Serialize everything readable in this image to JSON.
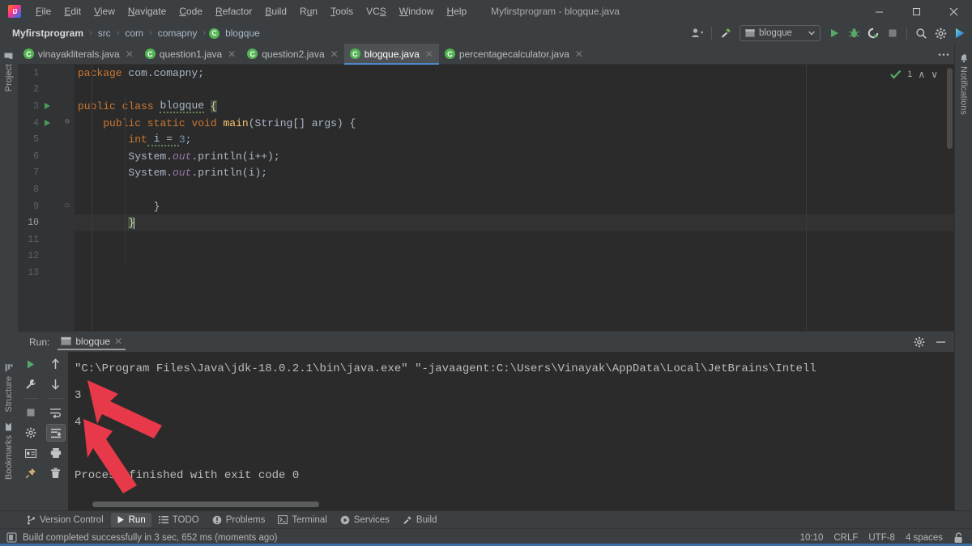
{
  "window": {
    "title": "Myfirstprogram - blogque.java",
    "minimize": "—",
    "maximize": "❐",
    "close": "✕"
  },
  "menu": [
    {
      "label": "File"
    },
    {
      "label": "Edit"
    },
    {
      "label": "View"
    },
    {
      "label": "Navigate"
    },
    {
      "label": "Code"
    },
    {
      "label": "Refactor"
    },
    {
      "label": "Build"
    },
    {
      "label": "Run"
    },
    {
      "label": "Tools"
    },
    {
      "label": "VCS"
    },
    {
      "label": "Window"
    },
    {
      "label": "Help"
    }
  ],
  "navbar": {
    "breadcrumb": [
      "Myfirstprogram",
      "src",
      "com",
      "comapny",
      "blogque"
    ],
    "separator": "›",
    "run_config": "blogque",
    "icons": [
      "user-icon",
      "hammer-icon",
      "run-icon",
      "debug-icon",
      "run-with-coverage-icon",
      "stop-icon",
      "search-icon",
      "settings-icon",
      "updates-icon"
    ]
  },
  "tool_strips": {
    "left_top": "Project",
    "left_mid": "Bookmarks",
    "left_bottom": "Structure",
    "right": "Notifications"
  },
  "editor_tabs": [
    {
      "label": "vinayakliterals.java",
      "active": false
    },
    {
      "label": "question1.java",
      "active": false
    },
    {
      "label": "question2.java",
      "active": false
    },
    {
      "label": "blogque.java",
      "active": true
    },
    {
      "label": "percentagecalculator.java",
      "active": false
    }
  ],
  "inspection": {
    "count": "1",
    "up": "∧",
    "down": "∨"
  },
  "code": {
    "lines": [
      {
        "n": "1",
        "runmark": false,
        "fold": "",
        "current": false
      },
      {
        "n": "2",
        "runmark": false,
        "fold": "",
        "current": false
      },
      {
        "n": "3",
        "runmark": true,
        "fold": "",
        "current": false
      },
      {
        "n": "4",
        "runmark": true,
        "fold": "⊖",
        "current": false
      },
      {
        "n": "5",
        "runmark": false,
        "fold": "",
        "current": false
      },
      {
        "n": "6",
        "runmark": false,
        "fold": "",
        "current": false
      },
      {
        "n": "7",
        "runmark": false,
        "fold": "",
        "current": false
      },
      {
        "n": "8",
        "runmark": false,
        "fold": "",
        "current": false
      },
      {
        "n": "9",
        "runmark": false,
        "fold": "⌂",
        "current": false
      },
      {
        "n": "10",
        "runmark": false,
        "fold": "",
        "current": true
      },
      {
        "n": "11",
        "runmark": false,
        "fold": "",
        "current": false
      },
      {
        "n": "12",
        "runmark": false,
        "fold": "",
        "current": false
      },
      {
        "n": "13",
        "runmark": false,
        "fold": "",
        "current": false
      }
    ],
    "text": {
      "l1_kw": "package",
      "l1_rest": " com.comapny;",
      "l3_kw1": "public",
      "l3_kw2": "class",
      "l3_name": "blogque",
      "l3_brace": "{",
      "l4_kw1": "public",
      "l4_kw2": "static",
      "l4_kw3": "void",
      "l4_name": "main",
      "l4_rest": "(String[] args) {",
      "l5_kw": "int",
      "l5_var": " i = ",
      "l5_num": "3",
      "l5_semi": ";",
      "l6_a": "System.",
      "l6_out": "out",
      "l6_b": ".println(i++);",
      "l7_a": "System.",
      "l7_out": "out",
      "l7_b": ".println(i);",
      "l9_brace": "}",
      "l10_brace": "}"
    }
  },
  "run_panel": {
    "label": "Run:",
    "tab": "blogque",
    "close": "✕",
    "settings_icon": "gear-icon",
    "minimize_icon": "minimize-icon",
    "tool_icons_left": [
      "rerun-icon",
      "wrench-icon",
      "stop-icon",
      "gear-icon",
      "layout-icon",
      "pin-icon"
    ],
    "tool_icons_right": [
      "up-arrow-icon",
      "down-arrow-icon",
      "soft-wrap-icon",
      "scroll-to-end-icon",
      "print-icon",
      "trash-icon"
    ],
    "console": [
      "\"C:\\Program Files\\Java\\jdk-18.0.2.1\\bin\\java.exe\" \"-javaagent:C:\\Users\\Vinayak\\AppData\\Local\\JetBrains\\Intell",
      "3",
      "4",
      "",
      "Process finished with exit code 0"
    ]
  },
  "bottom_bar": [
    {
      "label": "Version Control",
      "icon": "branch-icon",
      "active": false
    },
    {
      "label": "Run",
      "icon": "run-icon",
      "active": true
    },
    {
      "label": "TODO",
      "icon": "list-icon",
      "active": false
    },
    {
      "label": "Problems",
      "icon": "warning-icon",
      "active": false
    },
    {
      "label": "Terminal",
      "icon": "terminal-icon",
      "active": false
    },
    {
      "label": "Services",
      "icon": "services-icon",
      "active": false
    },
    {
      "label": "Build",
      "icon": "hammer-icon",
      "active": false
    }
  ],
  "status_bar": {
    "message": "Build completed successfully in 3 sec, 652 ms (moments ago)",
    "caret_position": "10:10",
    "line_separator": "CRLF",
    "encoding": "UTF-8",
    "indent": "4 spaces",
    "lock_icon": "lock-icon"
  },
  "annotations": {
    "arrow_color": "#e8394a",
    "arrow_count": 2,
    "targets": [
      "console-output-3",
      "console-output-4"
    ]
  },
  "colors": {
    "background": "#3c3f41",
    "editor_bg": "#2b2b2b",
    "gutter_bg": "#313335",
    "accent_blue": "#4a88c7",
    "keyword": "#cc7832",
    "number": "#6897bb",
    "field": "#9876aa",
    "text": "#a9b7c6",
    "run_green": "#499c54",
    "status_blue": "#3a6ea5"
  }
}
